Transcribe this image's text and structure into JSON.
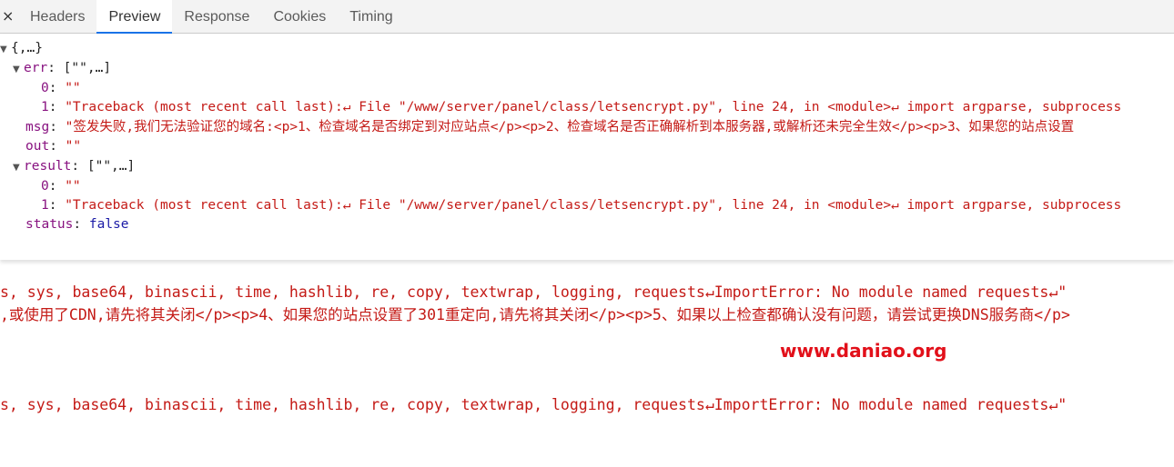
{
  "tabbar": {
    "close_glyph": "×",
    "tabs": [
      {
        "label": "Headers"
      },
      {
        "label": "Preview",
        "active": true
      },
      {
        "label": "Response"
      },
      {
        "label": "Cookies"
      },
      {
        "label": "Timing"
      }
    ]
  },
  "preview": {
    "root_summary": "{,…}",
    "err": {
      "key": "err",
      "summary": "[\"\",…]",
      "item0_index": "0",
      "item0_value": "\"\"",
      "item1_index": "1",
      "item1_value": "\"Traceback (most recent call last):↵  File \"/www/server/panel/class/letsencrypt.py\", line 24, in <module>↵    import argparse, subprocess"
    },
    "msg": {
      "key": "msg",
      "value": "\"签发失败,我们无法验证您的域名:<p>1、检查域名是否绑定到对应站点</p><p>2、检查域名是否正确解析到本服务器,或解析还未完全生效</p><p>3、如果您的站点设置"
    },
    "out": {
      "key": "out",
      "value": "\"\""
    },
    "result": {
      "key": "result",
      "summary": "[\"\",…]",
      "item0_index": "0",
      "item0_value": "\"\"",
      "item1_index": "1",
      "item1_value": "\"Traceback (most recent call last):↵  File \"/www/server/panel/class/letsencrypt.py\", line 24, in <module>↵    import argparse, subprocess"
    },
    "status": {
      "key": "status",
      "value": "false"
    }
  },
  "behind": {
    "line1": "s, sys, base64, binascii, time, hashlib, re, copy, textwrap, logging, requests↵ImportError: No module named requests↵\"",
    "line2": ",或使用了CDN,请先将其关闭</p><p>4、如果您的站点设置了301重定向,请先将其关闭</p><p>5、如果以上检查都确认没有问题，请尝试更换DNS服务商</p>",
    "line3": "s, sys, base64, binascii, time, hashlib, re, copy, textwrap, logging, requests↵ImportError: No module named requests↵\"",
    "watermark": "www.daniao.org"
  },
  "colors": {
    "key": "#881280",
    "string": "#c41a16",
    "boolean": "#1a1aa6",
    "active_tab_underline": "#1a73e8",
    "watermark": "#e2101a"
  }
}
